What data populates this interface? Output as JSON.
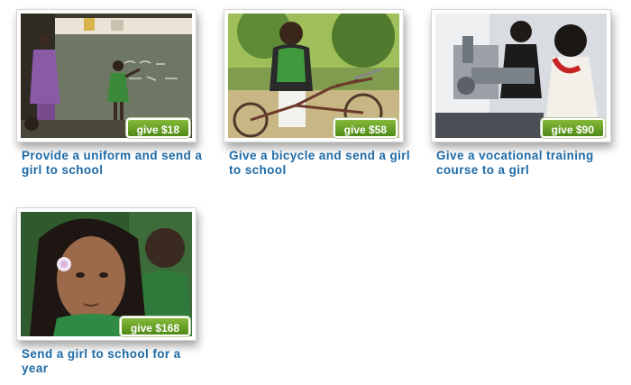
{
  "cards": [
    {
      "button": "give $18",
      "caption": "Provide a uniform and send a girl to school",
      "photo": "girl-at-chalkboard-classroom-photo"
    },
    {
      "button": "give $58",
      "caption": "Give a bicycle and send a girl to school",
      "photo": "girl-with-bicycle-photo"
    },
    {
      "button": "give $90",
      "caption": "Give a vocational training course to a girl",
      "photo": "girls-at-sewing-machine-photo"
    },
    {
      "button": "give $168",
      "caption": "Send a girl to school for a year",
      "photo": "schoolgirl-portrait-photo"
    }
  ],
  "colors": {
    "caption": "#1d6aa6",
    "button_top": "#86b93a",
    "button_bottom": "#4f8a17"
  }
}
